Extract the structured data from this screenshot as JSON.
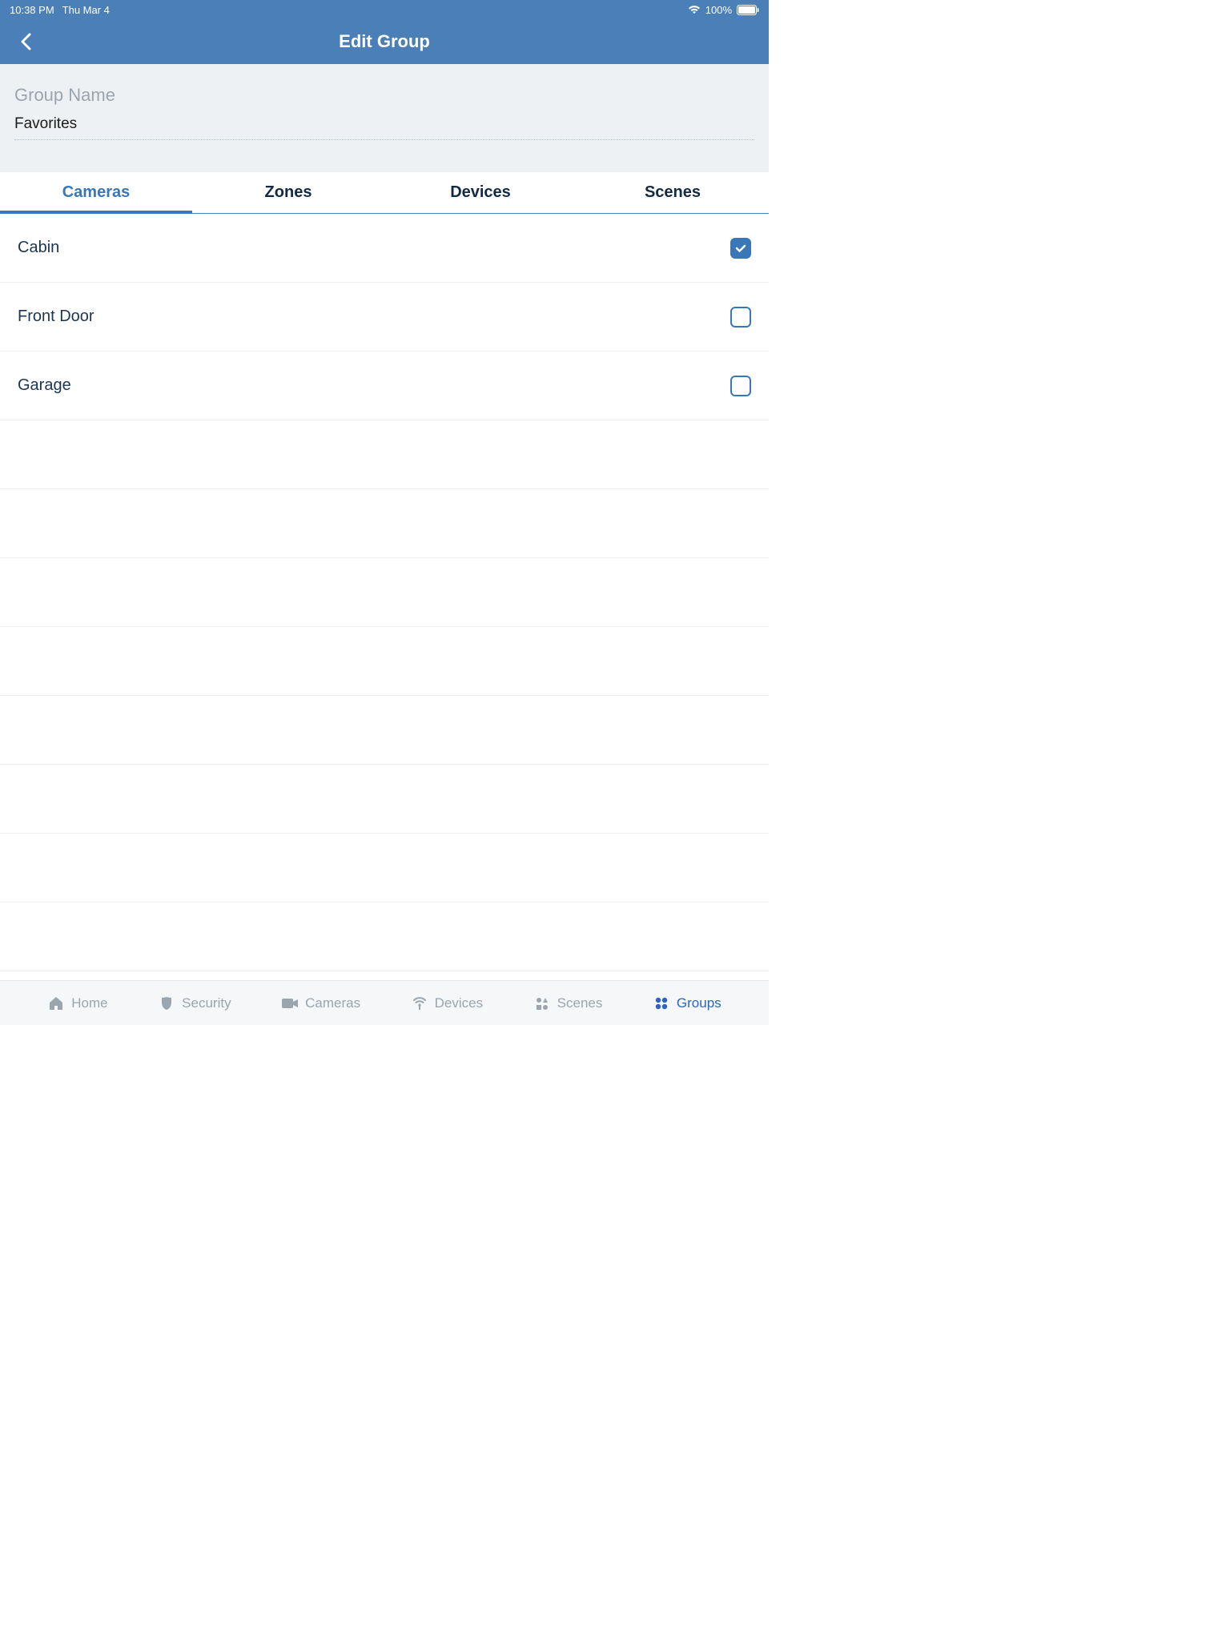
{
  "status": {
    "time": "10:38 PM",
    "date": "Thu Mar 4",
    "battery": "100%"
  },
  "header": {
    "title": "Edit Group"
  },
  "group_name": {
    "label": "Group Name",
    "value": "Favorites"
  },
  "tabs": [
    {
      "label": "Cameras",
      "active": true
    },
    {
      "label": "Zones",
      "active": false
    },
    {
      "label": "Devices",
      "active": false
    },
    {
      "label": "Scenes",
      "active": false
    }
  ],
  "items": [
    {
      "label": "Cabin",
      "checked": true
    },
    {
      "label": "Front Door",
      "checked": false
    },
    {
      "label": "Garage",
      "checked": false
    }
  ],
  "bottom_nav": [
    {
      "label": "Home",
      "icon": "home",
      "active": false
    },
    {
      "label": "Security",
      "icon": "shield",
      "active": false
    },
    {
      "label": "Cameras",
      "icon": "camera",
      "active": false
    },
    {
      "label": "Devices",
      "icon": "broadcast",
      "active": false
    },
    {
      "label": "Scenes",
      "icon": "scenes",
      "active": false
    },
    {
      "label": "Groups",
      "icon": "grid",
      "active": true
    }
  ]
}
